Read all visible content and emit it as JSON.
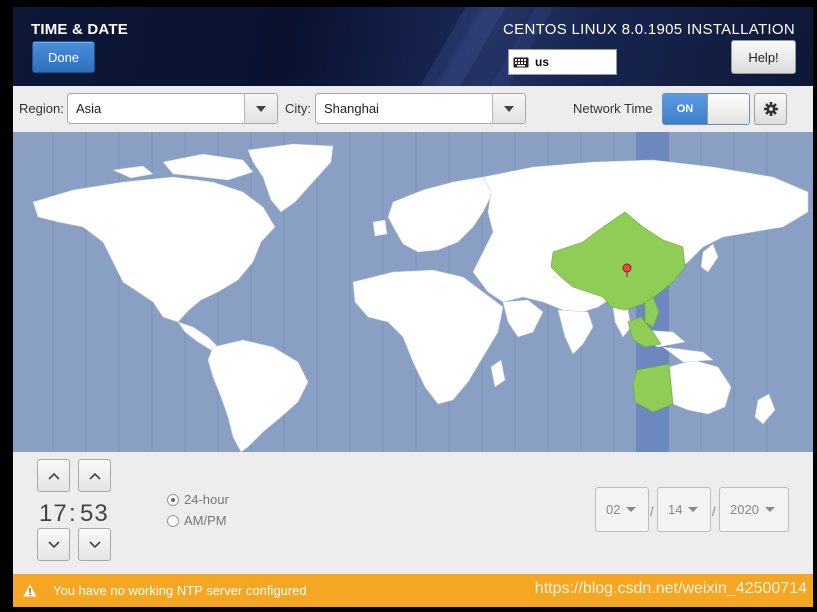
{
  "header": {
    "title": "TIME & DATE",
    "done_label": "Done",
    "product": "CENTOS LINUX 8.0.1905 INSTALLATION",
    "keyboard_layout": "us",
    "help_label": "Help!"
  },
  "toolbar": {
    "region_label": "Region:",
    "region_value": "Asia",
    "city_label": "City:",
    "city_value": "Shanghai",
    "network_time_label": "Network Time",
    "network_time_state": "ON"
  },
  "map": {
    "selected_zone_color": "#8fcd57",
    "ocean_color": "#8a9fc4",
    "land_color": "#ffffff",
    "highlight_band_color": "#6c88bf",
    "marker_color": "#e84a4a"
  },
  "clock": {
    "hours": "17",
    "separator": ":",
    "minutes": "53",
    "format_24": "24-hour",
    "format_ampm": "AM/PM",
    "selected_format": "24-hour"
  },
  "date": {
    "month": "02",
    "day": "14",
    "year": "2020",
    "separator": "/"
  },
  "warning": {
    "message": "You have no working NTP server configured",
    "watermark": "https://blog.csdn.net/weixin_42500714",
    "color": "#f5a623"
  }
}
